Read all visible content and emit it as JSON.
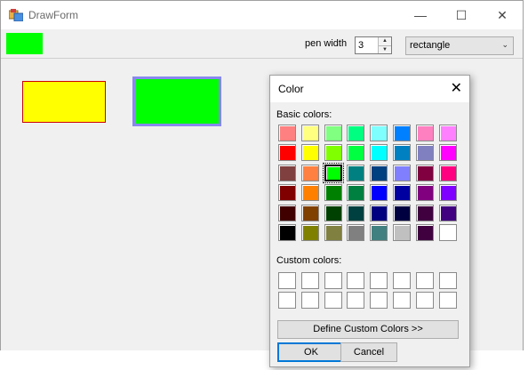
{
  "main_window": {
    "title": "DrawForm",
    "caption": {
      "minimize": "—",
      "maximize": "☐",
      "close": "✕"
    }
  },
  "toolbar": {
    "current_color": "#00ff00",
    "pen_width_label": "pen width",
    "pen_width_value": "3",
    "shape_selected": "rectangle"
  },
  "canvas": {
    "shapes": [
      {
        "type": "rectangle",
        "fill": "#ffff00",
        "stroke": "#cc0000"
      },
      {
        "type": "rectangle",
        "fill": "#00ff00",
        "stroke": "#8888ee"
      }
    ]
  },
  "color_dialog": {
    "title": "Color",
    "close_glyph": "✕",
    "basic_label": "Basic colors:",
    "custom_label": "Custom colors:",
    "define_button": "Define Custom Colors >>",
    "ok_button": "OK",
    "cancel_button": "Cancel",
    "selected_index": 18,
    "basic_colors": [
      "#ff8080",
      "#ffff80",
      "#80ff80",
      "#00ff80",
      "#80ffff",
      "#0080ff",
      "#ff80c0",
      "#ff80ff",
      "#ff0000",
      "#ffff00",
      "#80ff00",
      "#00ff40",
      "#00ffff",
      "#0080c0",
      "#8080c0",
      "#ff00ff",
      "#804040",
      "#ff8040",
      "#00ff00",
      "#008080",
      "#004080",
      "#8080ff",
      "#800040",
      "#ff0080",
      "#800000",
      "#ff8000",
      "#008000",
      "#008040",
      "#0000ff",
      "#0000a0",
      "#800080",
      "#8000ff",
      "#400000",
      "#804000",
      "#004000",
      "#004040",
      "#000080",
      "#000040",
      "#400040",
      "#400080",
      "#000000",
      "#808000",
      "#808040",
      "#808080",
      "#408080",
      "#c0c0c0",
      "#400040",
      "#ffffff"
    ],
    "custom_colors": [
      "#ffffff",
      "#ffffff",
      "#ffffff",
      "#ffffff",
      "#ffffff",
      "#ffffff",
      "#ffffff",
      "#ffffff",
      "#ffffff",
      "#ffffff",
      "#ffffff",
      "#ffffff",
      "#ffffff",
      "#ffffff",
      "#ffffff",
      "#ffffff"
    ]
  }
}
